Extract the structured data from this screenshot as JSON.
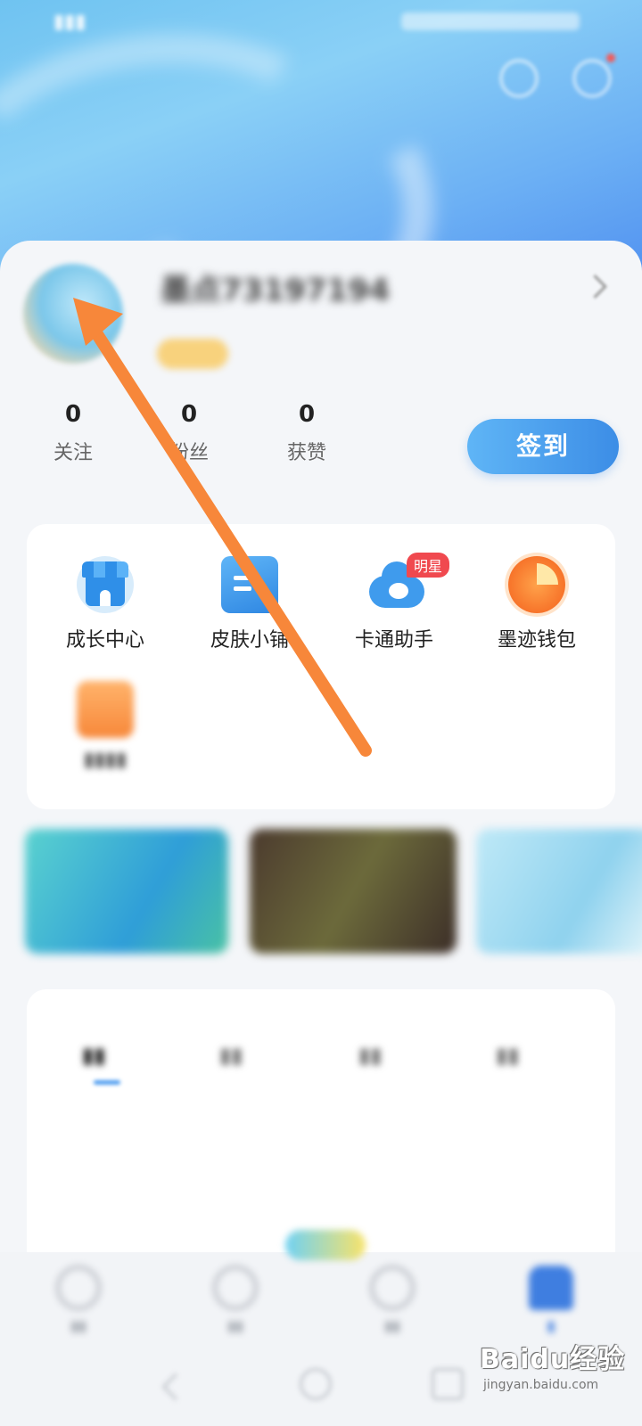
{
  "profile": {
    "username": "墨点73197194",
    "badge": "",
    "stats": [
      {
        "value": "0",
        "label": "关注"
      },
      {
        "value": "0",
        "label": "粉丝"
      },
      {
        "value": "0",
        "label": "获赞"
      }
    ],
    "sign_in_label": "签到"
  },
  "menu": {
    "items": [
      {
        "label": "成长中心",
        "icon": "store-icon"
      },
      {
        "label": "皮肤小铺",
        "icon": "skin-shop-icon"
      },
      {
        "label": "卡通助手",
        "icon": "cartoon-cloud-icon",
        "badge": "明星"
      },
      {
        "label": "墨迹钱包",
        "icon": "wallet-pie-icon"
      },
      {
        "label": "",
        "icon": "gift-icon"
      }
    ]
  },
  "tabs": [
    "",
    "",
    "",
    ""
  ],
  "bottom_nav": [
    "",
    "",
    "",
    ""
  ],
  "watermark": {
    "logo": "Baidu经验",
    "url": "jingyan.baidu.com"
  },
  "colors": {
    "accent": "#3c8de6",
    "badge_red": "#f0494f",
    "annotation_arrow": "#f7873a"
  }
}
